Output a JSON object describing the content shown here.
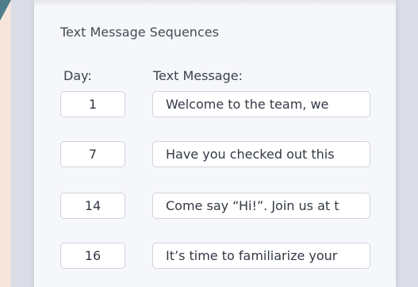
{
  "section": {
    "title": "Text Message Sequences",
    "day_header": "Day:",
    "message_header": "Text Message:"
  },
  "rows": [
    {
      "day": "1",
      "message": "Welcome to the team, we"
    },
    {
      "day": "7",
      "message": "Have you checked out this"
    },
    {
      "day": "14",
      "message": "Come say “Hi!”. Join us at t"
    },
    {
      "day": "16",
      "message": "It’s time to familiarize your"
    }
  ]
}
